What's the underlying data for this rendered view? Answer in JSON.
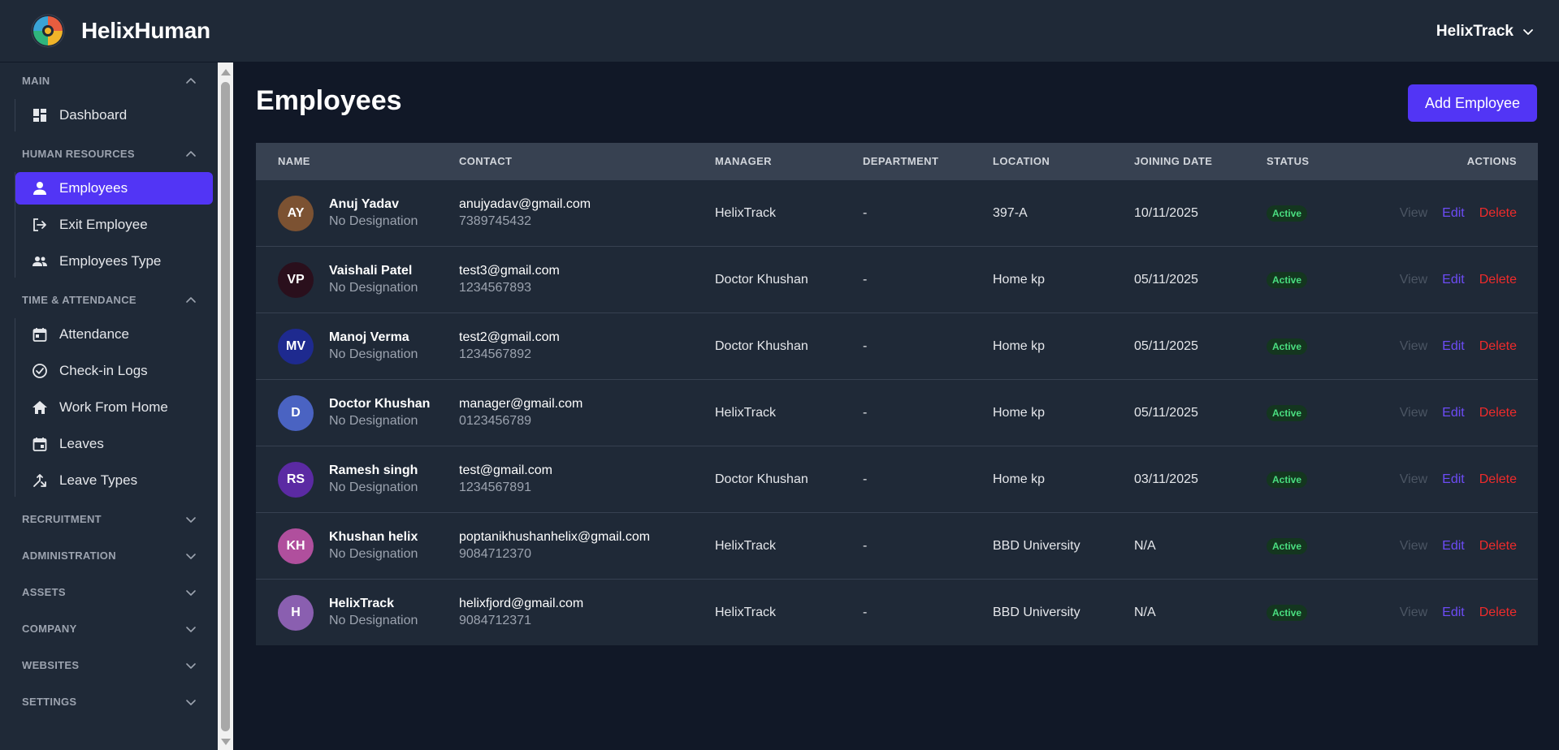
{
  "app": {
    "name": "HelixHuman",
    "account": "HelixTrack",
    "accent": "#5235f5"
  },
  "sidebar": {
    "sections": [
      {
        "title": "MAIN",
        "expanded": true,
        "items": [
          {
            "label": "Dashboard",
            "icon": "dashboard-icon"
          }
        ]
      },
      {
        "title": "HUMAN RESOURCES",
        "expanded": true,
        "items": [
          {
            "label": "Employees",
            "icon": "person-icon",
            "active": true
          },
          {
            "label": "Exit Employee",
            "icon": "exit-icon"
          },
          {
            "label": "Employees Type",
            "icon": "people-icon"
          }
        ]
      },
      {
        "title": "TIME & ATTENDANCE",
        "expanded": true,
        "items": [
          {
            "label": "Attendance",
            "icon": "calendar-icon"
          },
          {
            "label": "Check-in Logs",
            "icon": "check-circle-icon"
          },
          {
            "label": "Work From Home",
            "icon": "home-icon"
          },
          {
            "label": "Leaves",
            "icon": "calendar-event-icon"
          },
          {
            "label": "Leave Types",
            "icon": "merge-arrows-icon"
          }
        ]
      },
      {
        "title": "RECRUITMENT",
        "expanded": false
      },
      {
        "title": "ADMINISTRATION",
        "expanded": false
      },
      {
        "title": "ASSETS",
        "expanded": false
      },
      {
        "title": "COMPANY",
        "expanded": false
      },
      {
        "title": "WEBSITES",
        "expanded": false
      },
      {
        "title": "SETTINGS",
        "expanded": false
      }
    ]
  },
  "page": {
    "title": "Employees",
    "add_button": "Add Employee"
  },
  "table": {
    "columns": [
      "NAME",
      "CONTACT",
      "MANAGER",
      "DEPARTMENT",
      "LOCATION",
      "JOINING DATE",
      "STATUS",
      "ACTIONS"
    ],
    "actions": {
      "view": "View",
      "edit": "Edit",
      "delete": "Delete"
    },
    "rows": [
      {
        "initials": "AY",
        "avatar_color": "#7c5232",
        "name": "Anuj Yadav",
        "designation": "No Designation",
        "email": "anujyadav@gmail.com",
        "phone": "7389745432",
        "manager": "HelixTrack",
        "department": "-",
        "location": "397-A",
        "joining_date": "10/11/2025",
        "status": "Active"
      },
      {
        "initials": "VP",
        "avatar_color": "#2a0f1c",
        "name": "Vaishali Patel",
        "designation": "No Designation",
        "email": "test3@gmail.com",
        "phone": "1234567893",
        "manager": "Doctor Khushan",
        "department": "-",
        "location": "Home kp",
        "joining_date": "05/11/2025",
        "status": "Active"
      },
      {
        "initials": "MV",
        "avatar_color": "#1e2a8f",
        "name": "Manoj Verma",
        "designation": "No Designation",
        "email": "test2@gmail.com",
        "phone": "1234567892",
        "manager": "Doctor Khushan",
        "department": "-",
        "location": "Home kp",
        "joining_date": "05/11/2025",
        "status": "Active"
      },
      {
        "initials": "D",
        "avatar_color": "#4a63c2",
        "name": "Doctor Khushan",
        "designation": "No Designation",
        "email": "manager@gmail.com",
        "phone": "0123456789",
        "manager": "HelixTrack",
        "department": "-",
        "location": "Home kp",
        "joining_date": "05/11/2025",
        "status": "Active"
      },
      {
        "initials": "RS",
        "avatar_color": "#5b2aa3",
        "name": "Ramesh singh",
        "designation": "No Designation",
        "email": "test@gmail.com",
        "phone": "1234567891",
        "manager": "Doctor Khushan",
        "department": "-",
        "location": "Home kp",
        "joining_date": "03/11/2025",
        "status": "Active"
      },
      {
        "initials": "KH",
        "avatar_color": "#b04f9d",
        "name": "Khushan helix",
        "designation": "No Designation",
        "email": "poptanikhushanhelix@gmail.com",
        "phone": "9084712370",
        "manager": "HelixTrack",
        "department": "-",
        "location": "BBD University",
        "joining_date": "N/A",
        "status": "Active"
      },
      {
        "initials": "H",
        "avatar_color": "#8a5fb0",
        "name": "HelixTrack",
        "designation": "No Designation",
        "email": "helixfjord@gmail.com",
        "phone": "9084712371",
        "manager": "HelixTrack",
        "department": "-",
        "location": "BBD University",
        "joining_date": "N/A",
        "status": "Active"
      }
    ]
  }
}
